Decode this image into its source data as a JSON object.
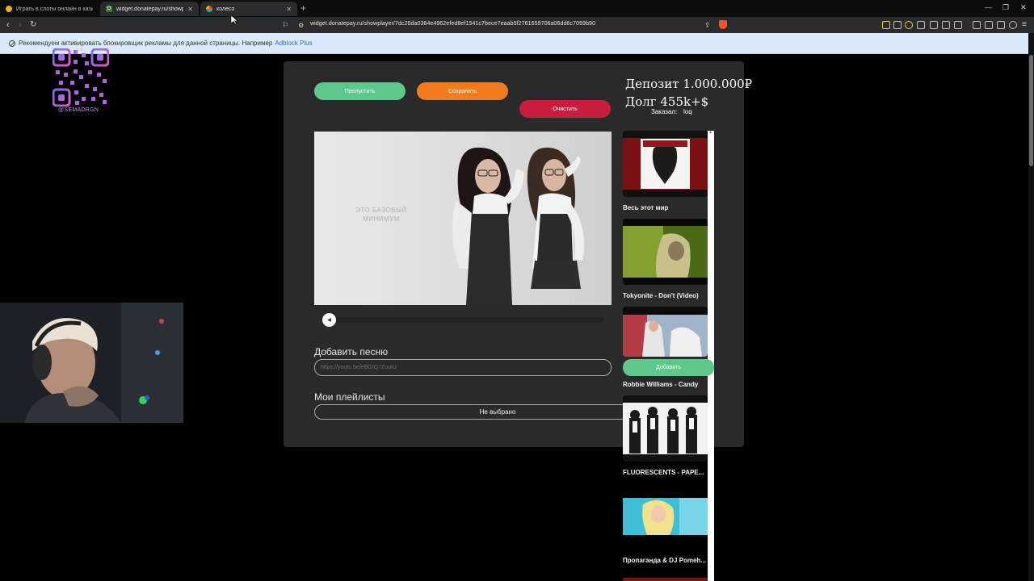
{
  "browser": {
    "tabs": [
      {
        "title": "Играть в слоты онлайн в казино Д",
        "favicon_color": "#e2b80c"
      },
      {
        "title": "widget.donatepay.ru/showpl",
        "favicon_color": "#3a7a3a",
        "favicon_letter": "D"
      },
      {
        "title": "колесо",
        "favicon_color": "#3b82f6"
      }
    ],
    "url": "widget.donatepay.ru/showplayer/7dc26da0364e4962efed8ef1541c7bece7eaab5f2761659706a06dd6c7099b90"
  },
  "adblock_bar": {
    "text": "Рекомендуем активировать блокировщик рекламы для данной страницы. Например",
    "link": "Adblock Plus"
  },
  "overlay": {
    "deposit": "Депозит 1.000.000₽",
    "debt": "Долг  455k+$",
    "qr_caption": "@SEMADRGN"
  },
  "player": {
    "skip_label": "Пропустить",
    "save_label": "Сохранить",
    "clear_label": "Очистить",
    "ordered_label": "Заказал:",
    "ordered_by": "loq",
    "video_caption": "ЭТО БАЗОВЫЙ МИНИМУМ",
    "progress": 0.0
  },
  "add_song": {
    "heading": "Добавить песню",
    "placeholder": "https://youtu.be/eBGIQ7ZuuiU"
  },
  "playlists": {
    "heading": "Мои плейлисты",
    "selected": "Не выбрано"
  },
  "playlist_items": [
    {
      "title": "Весь этот мир"
    },
    {
      "title": "Tokyonite - Don't (Video)"
    },
    {
      "title": "Robbie Williams - Candy"
    },
    {
      "title": "FLUORESCENTS - PAPE..."
    },
    {
      "title": "Пропаганда & DJ Pomeh..."
    }
  ],
  "playlist_add_label": "Добавить",
  "colors": {
    "skip": "#5ec78b",
    "save": "#f07c1e",
    "clear": "#c81d3c",
    "panel": "#2a2a2b"
  }
}
